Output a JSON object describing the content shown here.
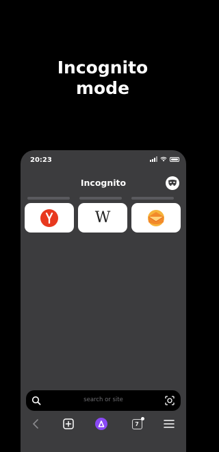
{
  "headline": {
    "line1": "Incognito",
    "line2": "mode"
  },
  "status_bar": {
    "time": "20:23"
  },
  "header": {
    "title": "Incognito"
  },
  "tiles": [
    {
      "name": "Yandex",
      "icon": "yandex-logo-icon"
    },
    {
      "name": "Wikipedia",
      "icon": "wikipedia-logo-icon",
      "glyph": "W"
    },
    {
      "name": "Mail",
      "icon": "mail-envelope-icon"
    }
  ],
  "search": {
    "placeholder": "search or site"
  },
  "toolbar": {
    "tabs_count": "7"
  },
  "colors": {
    "background": "#000000",
    "panel": "#3c3c3e",
    "alice": "#8a49f5",
    "yandex": "#e8391f",
    "mail": "#f6b43b"
  }
}
